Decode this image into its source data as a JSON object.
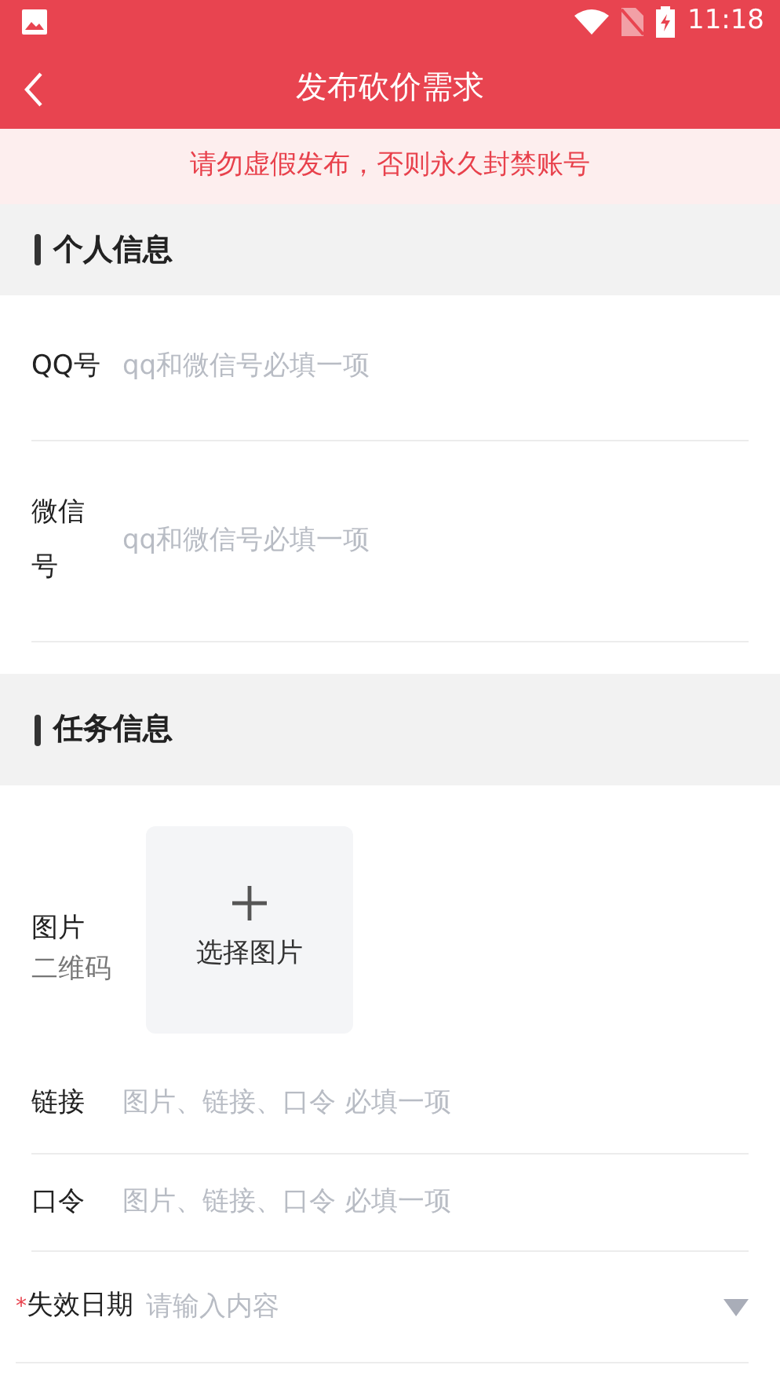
{
  "status_bar": {
    "time": "11:18"
  },
  "header": {
    "title": "发布砍价需求"
  },
  "notice": "请勿虚假发布，否则永久封禁账号",
  "sections": [
    {
      "title": "个人信息",
      "fields": [
        {
          "kind": "text",
          "label": "QQ号",
          "placeholder": "qq和微信号必填一项"
        },
        {
          "kind": "text",
          "label": "微信号",
          "placeholder": "qq和微信号必填一项"
        }
      ]
    },
    {
      "title": "任务信息",
      "fields": [
        {
          "kind": "image",
          "label": "图片",
          "sublabel": "二维码",
          "button_label": "选择图片"
        },
        {
          "kind": "text",
          "label": "链接",
          "placeholder": "图片、链接、口令 必填一项"
        },
        {
          "kind": "text",
          "label": "口令",
          "placeholder": "图片、链接、口令 必填一项"
        },
        {
          "kind": "select",
          "required_mark": "*",
          "label": "失效日期",
          "placeholder": "请输入内容"
        }
      ]
    }
  ]
}
